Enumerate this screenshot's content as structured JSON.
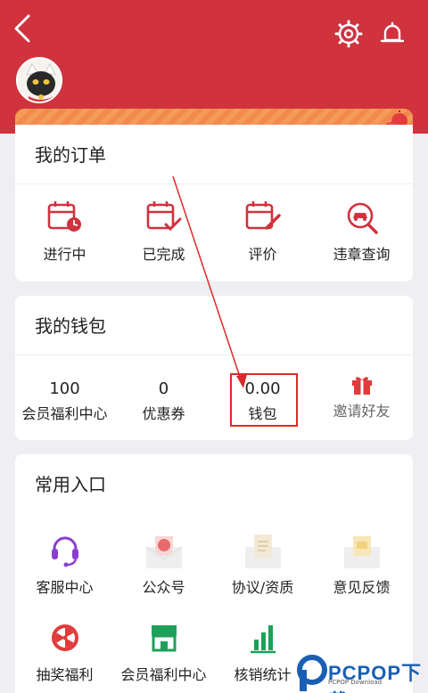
{
  "colors": {
    "brand_red": "#d0323e",
    "accent_red": "#d92b2b"
  },
  "header": {
    "back_icon": "back-chevron-icon",
    "settings_icon": "gear-icon",
    "notify_icon": "bell-icon"
  },
  "orders": {
    "title": "我的订单",
    "items": [
      {
        "label": "进行中",
        "icon": "calendar-clock-icon"
      },
      {
        "label": "已完成",
        "icon": "calendar-check-icon"
      },
      {
        "label": "评价",
        "icon": "calendar-edit-icon"
      },
      {
        "label": "违章查询",
        "icon": "car-search-icon"
      }
    ]
  },
  "wallet": {
    "title": "我的钱包",
    "items": [
      {
        "value": "100",
        "label": "会员福利中心"
      },
      {
        "value": "0",
        "label": "优惠券"
      },
      {
        "value": "0.00",
        "label": "钱包"
      },
      {
        "value": "",
        "label": "邀请好友",
        "icon": "gift-icon"
      }
    ]
  },
  "entrances": {
    "title": "常用入口",
    "items": [
      {
        "label": "客服中心",
        "icon": "headset-icon"
      },
      {
        "label": "公众号",
        "icon": "badge-envelope-icon"
      },
      {
        "label": "协议/资质",
        "icon": "document-envelope-icon"
      },
      {
        "label": "意见反馈",
        "icon": "letter-envelope-icon"
      },
      {
        "label": "抽奖福利",
        "icon": "prize-wheel-icon"
      },
      {
        "label": "会员福利中心",
        "icon": "store-icon"
      },
      {
        "label": "核销统计",
        "icon": "bar-chart-icon"
      }
    ]
  },
  "watermark": {
    "brand": "PCPOP下载",
    "sub": "PCPOP Download"
  }
}
